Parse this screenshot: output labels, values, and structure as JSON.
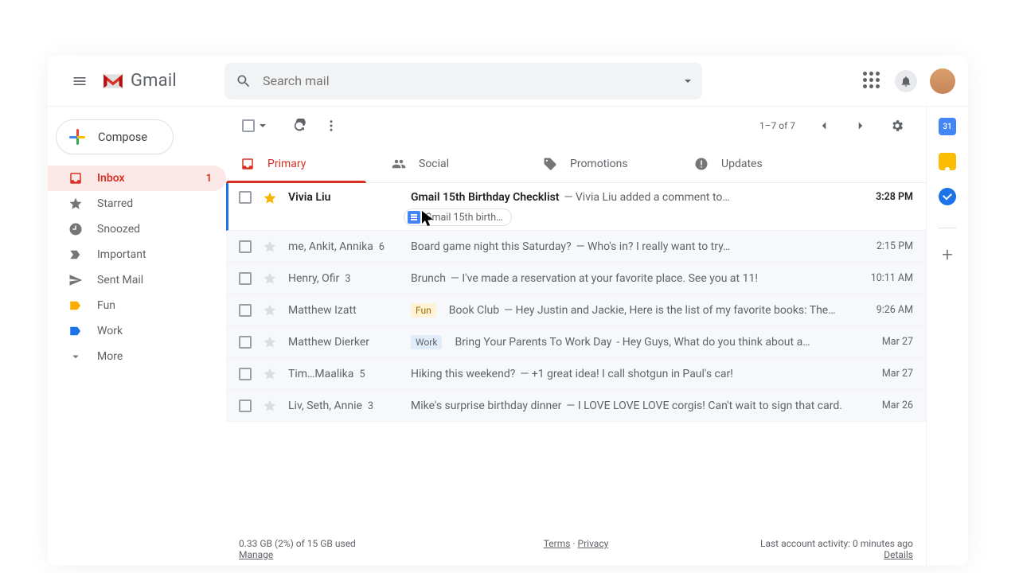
{
  "app_name": "Gmail",
  "search": {
    "placeholder": "Search mail"
  },
  "compose_label": "Compose",
  "sidebar": [
    {
      "key": "inbox",
      "label": "Inbox",
      "count": "1",
      "active": true
    },
    {
      "key": "starred",
      "label": "Starred"
    },
    {
      "key": "snoozed",
      "label": "Snoozed"
    },
    {
      "key": "important",
      "label": "Important"
    },
    {
      "key": "sent",
      "label": "Sent Mail"
    },
    {
      "key": "fun",
      "label": "Fun",
      "cls": "fun"
    },
    {
      "key": "work",
      "label": "Work",
      "cls": "work"
    },
    {
      "key": "more",
      "label": "More"
    }
  ],
  "pager": "1–7 of 7",
  "tabs": [
    {
      "key": "primary",
      "label": "Primary",
      "active": true
    },
    {
      "key": "social",
      "label": "Social"
    },
    {
      "key": "promotions",
      "label": "Promotions"
    },
    {
      "key": "updates",
      "label": "Updates"
    }
  ],
  "rows": [
    {
      "sender": "Vivia Liu",
      "count": "",
      "subject": "Gmail 15th Birthday Checklist",
      "snippet": "Vivia Liu added a comment to…",
      "time": "3:28 PM",
      "unread": true,
      "starred": true,
      "attachment": "Gmail 15th birth…"
    },
    {
      "sender": "me, Ankit, Annika",
      "count": "6",
      "subject": "Board game night this Saturday?",
      "snippet": "Who's in? I really want to try…",
      "time": "2:15 PM",
      "unread": false
    },
    {
      "sender": "Henry, Ofir",
      "count": "3",
      "subject": "Brunch",
      "snippet": "I've made a reservation at your favorite place. See you at 11!",
      "time": "10:11 AM",
      "unread": false
    },
    {
      "sender": "Matthew Izatt",
      "count": "",
      "chip": "Fun",
      "chip_cls": "chip-fun",
      "subject": "Book Club",
      "snippet": "Hey Justin and Jackie, Here is the list of my favorite books: The…",
      "time": "9:26  AM",
      "unread": false
    },
    {
      "sender": "Matthew Dierker",
      "count": "",
      "chip": "Work",
      "chip_cls": "chip-work",
      "subject": "Bring Your Parents To Work Day",
      "snippet": "Hey Guys, What do you think about a…",
      "sep": " - ",
      "time": "Mar 27",
      "unread": false
    },
    {
      "sender": "Tim…Maalika",
      "count": "5",
      "subject": "Hiking this weekend?",
      "snippet": "+1 great idea! I call shotgun in Paul's car!",
      "time": "Mar 27",
      "unread": false
    },
    {
      "sender": "Liv, Seth, Annie",
      "count": "3",
      "subject": "Mike's surprise birthday dinner",
      "snippet": "I LOVE LOVE LOVE corgis! Can't wait to sign that card.",
      "time": "Mar 26",
      "unread": false
    }
  ],
  "footer": {
    "storage": "0.33 GB (2%) of 15 GB used",
    "manage": "Manage",
    "terms": "Terms",
    "privacy": "Privacy",
    "activity": "Last account activity: 0 minutes ago",
    "details": "Details"
  },
  "sidepanel_cal": "31"
}
